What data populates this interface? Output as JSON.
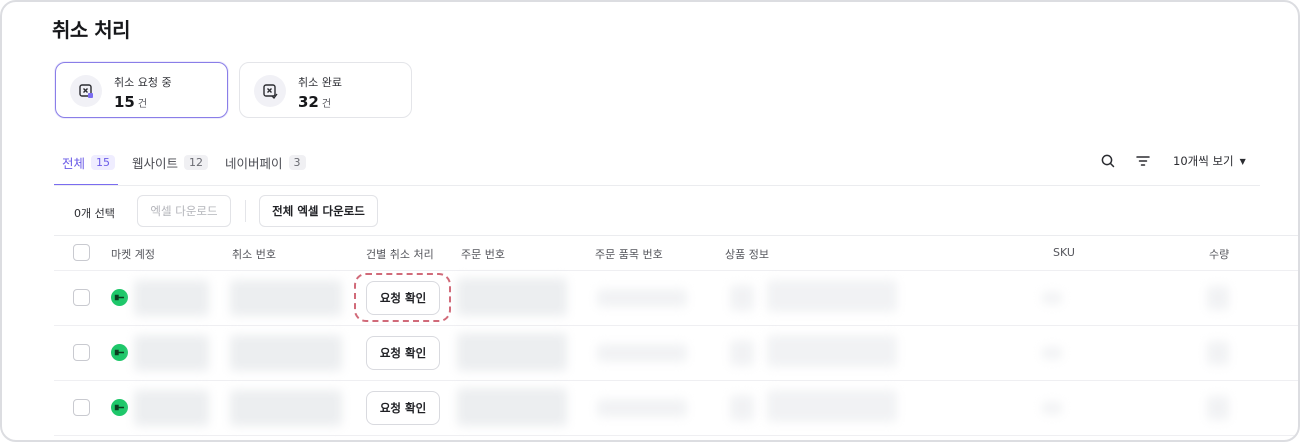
{
  "page": {
    "title": "취소 처리"
  },
  "summary_cards": [
    {
      "label": "취소 요청 중",
      "count": "15",
      "unit": "건",
      "icon": "cancel-request-icon"
    },
    {
      "label": "취소 완료",
      "count": "32",
      "unit": "건",
      "icon": "cancel-complete-icon"
    }
  ],
  "tabs": [
    {
      "label": "전체",
      "count": "15"
    },
    {
      "label": "웹사이트",
      "count": "12"
    },
    {
      "label": "네이버페이",
      "count": "3"
    }
  ],
  "toolbar": {
    "view_option": "10개씩 보기",
    "selected_count": "0개 선택",
    "excel_download": "엑셀 다운로드",
    "excel_download_all": "전체 엑셀 다운로드"
  },
  "table": {
    "headers": [
      "마켓 계정",
      "취소 번호",
      "건별 취소 처리",
      "주문 번호",
      "주문 품목 번호",
      "상품 정보",
      "SKU",
      "수량"
    ],
    "rows": [
      {
        "action": "요청 확인"
      },
      {
        "action": "요청 확인"
      },
      {
        "action": "요청 확인"
      }
    ]
  },
  "colors": {
    "accent": "#6b5ce7",
    "market_green": "#1ec76a",
    "highlight": "#d16a79"
  }
}
